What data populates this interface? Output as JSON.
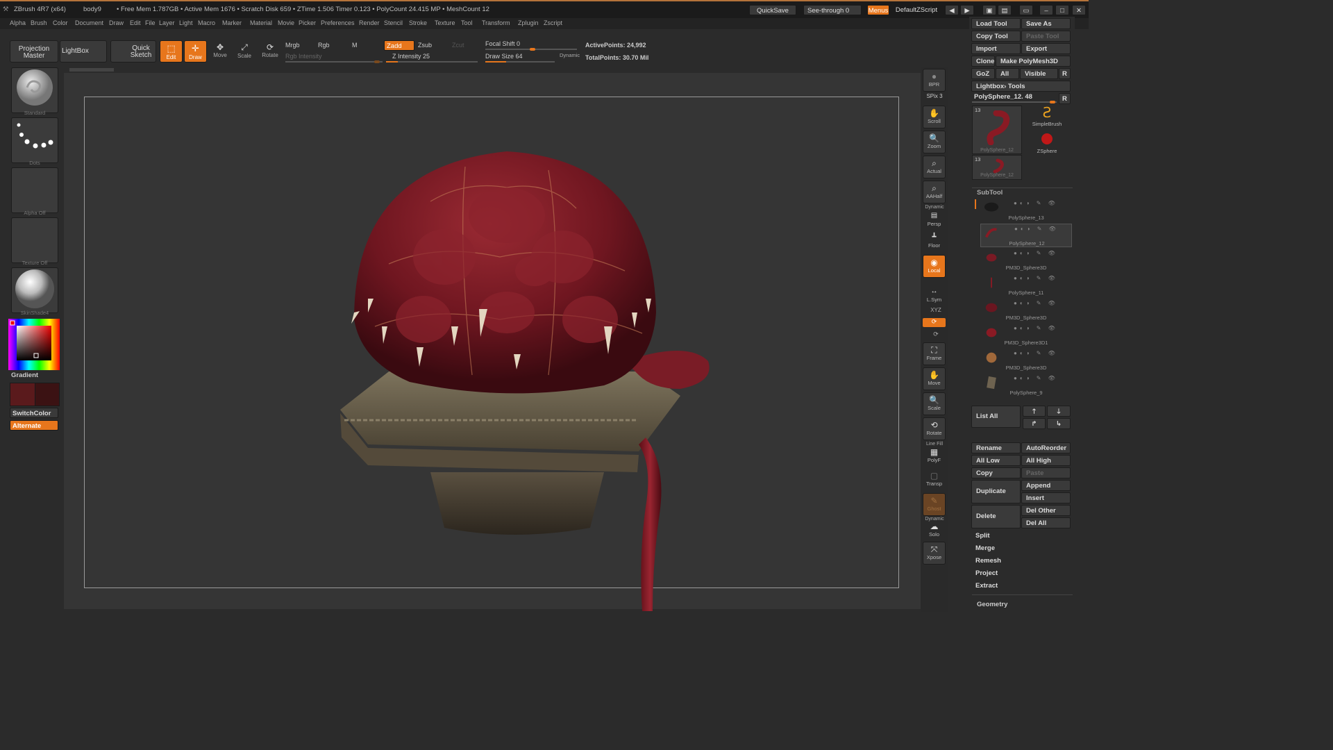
{
  "titlebar": {
    "app": "ZBrush 4R7 (x64)",
    "doc": "body9",
    "stats": "• Free Mem 1.787GB • Active Mem 1676 • Scratch Disk 659 • ZTime 1.506 Timer 0.123 • PolyCount 24.415 MP • MeshCount 12",
    "quicksave": "QuickSave",
    "seethrough": "See-through 0",
    "menus": "Menus",
    "script": "DefaultZScript"
  },
  "menus": [
    "Alpha",
    "Brush",
    "Color",
    "Document",
    "Draw",
    "Edit",
    "File",
    "Layer",
    "Light",
    "Macro",
    "Marker",
    "Material",
    "Movie",
    "Picker",
    "Preferences",
    "Render",
    "Stencil",
    "Stroke",
    "Texture",
    "Tool",
    "Transform",
    "Zplugin",
    "Zscript"
  ],
  "toolbar": {
    "projection_master": "Projection Master",
    "lightbox": "LightBox",
    "quick_sketch": "Quick Sketch",
    "edit": "Edit",
    "draw": "Draw",
    "move": "Move",
    "scale": "Scale",
    "rotate": "Rotate",
    "mrgb": "Mrgb",
    "rgb": "Rgb",
    "m": "M",
    "rgb_intensity": "Rgb Intensity",
    "zadd": "Zadd",
    "zsub": "Zsub",
    "zcut": "Zcut",
    "z_intensity": "Z Intensity 25",
    "z_intensity_value": 25,
    "focal_shift": "Focal Shift 0",
    "draw_size": "Draw Size 64",
    "draw_size_value": 64,
    "dynamic": "Dynamic",
    "active_points": "ActivePoints: 24,992",
    "total_points": "TotalPoints: 30.70 Mil"
  },
  "lefttray": {
    "brush": "Standard",
    "stroke": "Dots",
    "alpha": "Alpha Off",
    "texture": "Texture Off",
    "material": "SkinShade4",
    "gradient": "Gradient",
    "switchcolor": "SwitchColor",
    "alternate": "Alternate"
  },
  "rightshelf": {
    "bpr": "BPR",
    "spix": "SPix 3",
    "scroll": "Scroll",
    "zoom": "Zoom",
    "actual": "Actual",
    "aahalf": "AAHalf",
    "dynamic": "Dynamic",
    "persp": "Persp",
    "floor": "Floor",
    "local": "Local",
    "lsym": "L.Sym",
    "xyz": "XYZ",
    "frame": "Frame",
    "move": "Move",
    "scale": "Scale",
    "rotate": "Rotate",
    "linefill": "Line Fill",
    "polyf": "PolyF",
    "transp": "Transp",
    "ghost": "Ghost",
    "dynamic2": "Dynamic",
    "solo": "Solo",
    "xpose": "Xpose"
  },
  "toolpanel": {
    "load_tool": "Load Tool",
    "save_as": "Save As",
    "copy_tool": "Copy Tool",
    "paste_tool": "Paste Tool",
    "import": "Import",
    "export": "Export",
    "clone": "Clone",
    "make_polymesh": "Make PolyMesh3D",
    "goz": "GoZ",
    "all": "All",
    "visible": "Visible",
    "r": "R",
    "lightbox_tools": "Lightbox› Tools",
    "current_tool": "PolySphere_12. 48",
    "thumb_count": "13",
    "thumb_name": "PolySphere_12",
    "simplebrush": "SimpleBrush",
    "zsphere": "ZSphere",
    "subtool_header": "SubTool",
    "subtools": [
      "PolySphere_13",
      "PolySphere_12",
      "PM3D_Sphere3D",
      "PolySphere_11",
      "PM3D_Sphere3D",
      "PM3D_Sphere3D1",
      "PM3D_Sphere3D",
      "PolySphere_9"
    ],
    "list_all": "List All",
    "rename": "Rename",
    "autoreorder": "AutoReorder",
    "all_low": "All Low",
    "all_high": "All High",
    "copy": "Copy",
    "paste": "Paste",
    "duplicate": "Duplicate",
    "append": "Append",
    "insert": "Insert",
    "delete": "Delete",
    "del_other": "Del Other",
    "del_all": "Del All",
    "split": "Split",
    "merge": "Merge",
    "remesh": "Remesh",
    "project": "Project",
    "extract": "Extract",
    "geometry": "Geometry"
  },
  "colors": {
    "accent": "#e7761c",
    "creature": "#7a1a22",
    "pedestal": "#6e6350"
  }
}
